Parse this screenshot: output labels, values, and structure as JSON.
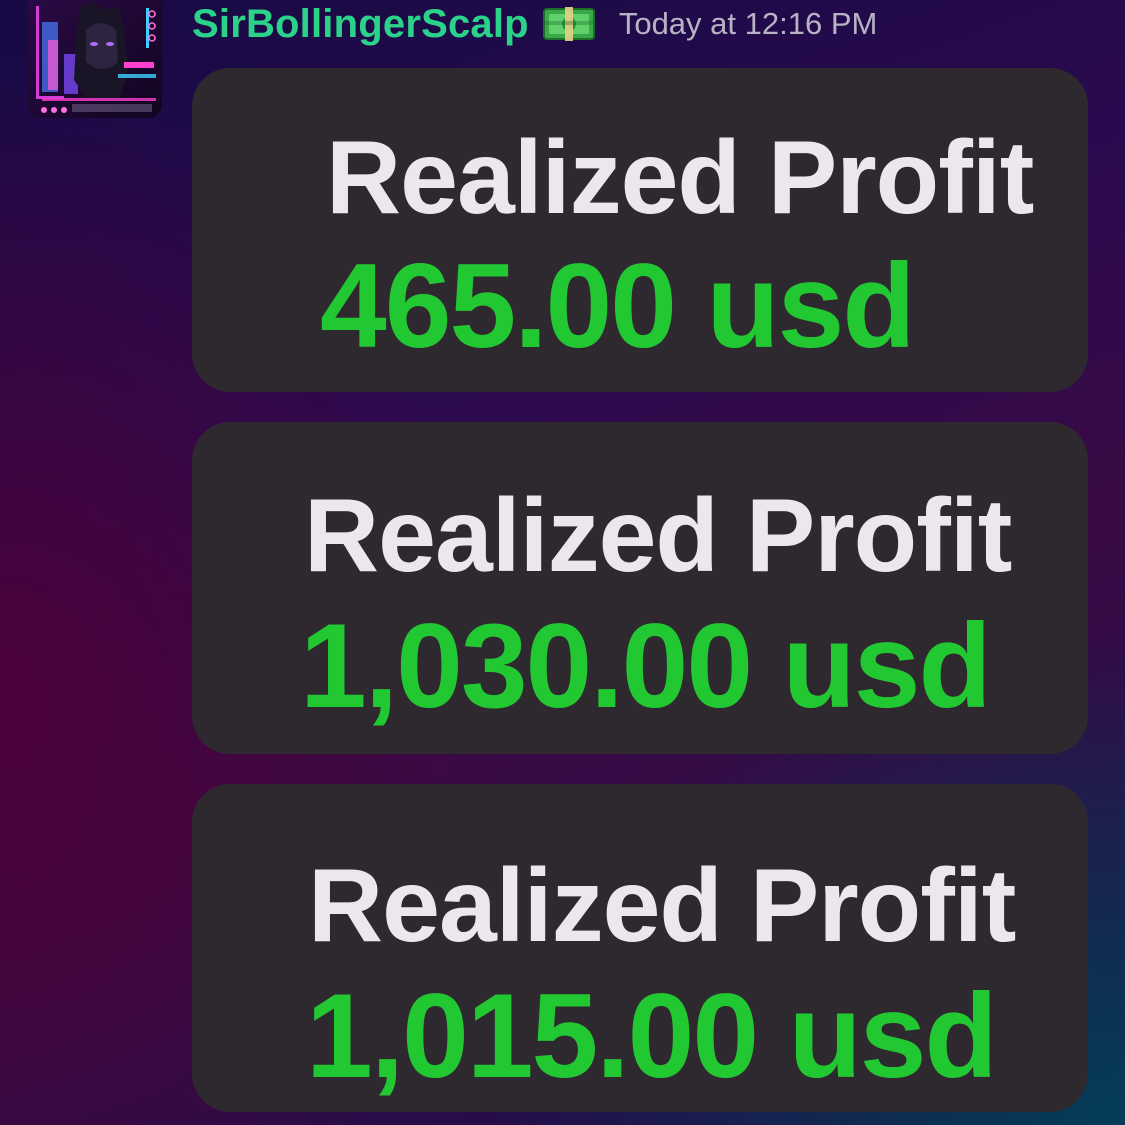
{
  "message": {
    "author": {
      "username": "SirBollingerScalp",
      "badge_icon": "money-banknote-icon",
      "name_color": "#2bd38a"
    },
    "timestamp": "Today at 12:16 PM",
    "profit_cards": [
      {
        "label": "Realized Profit",
        "value": "465.00 usd"
      },
      {
        "label": "Realized Profit",
        "value": "1,030.00 usd"
      },
      {
        "label": "Realized Profit",
        "value": "1,015.00 usd"
      }
    ]
  },
  "colors": {
    "profit_green": "#22c832",
    "card_background": "#2e292f",
    "label_text": "#ece6ee",
    "timestamp_text": "#b7b3c4"
  }
}
